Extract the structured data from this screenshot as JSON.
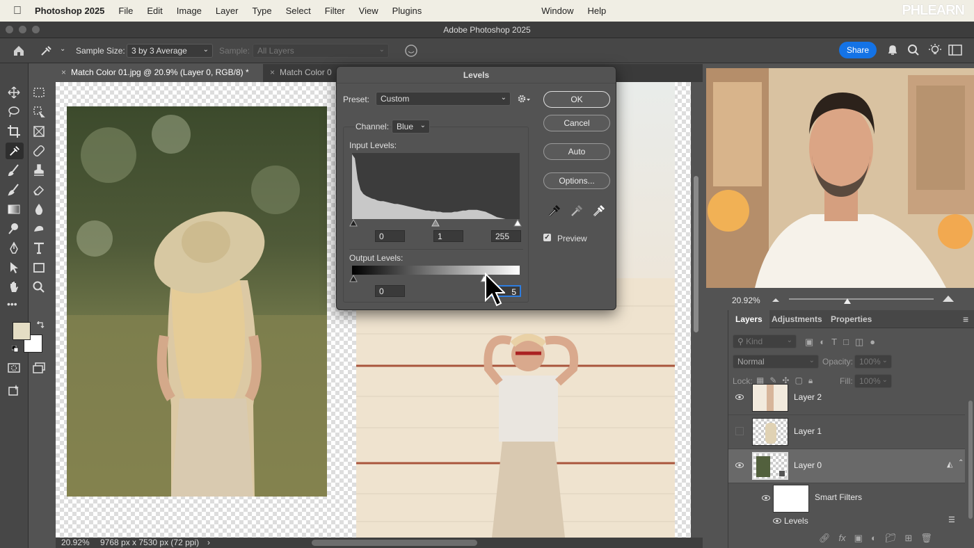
{
  "menubar": {
    "app_name": "Photoshop 2025",
    "items": [
      "File",
      "Edit",
      "Image",
      "Layer",
      "Type",
      "Select",
      "Filter",
      "View",
      "Plugins"
    ],
    "window": "Window",
    "help": "Help",
    "brand_watermark": "PHLEARN"
  },
  "window": {
    "title": "Adobe Photoshop 2025"
  },
  "options_bar": {
    "sample_size_label": "Sample Size:",
    "sample_size_value": "3 by 3 Average",
    "sample_label": "Sample:",
    "sample_value": "All Layers",
    "share_label": "Share",
    "accent_color": "#1473e6"
  },
  "tabs": [
    {
      "label": "Match Color 01.jpg @ 20.9% (Layer 0, RGB/8) *",
      "close": "×"
    },
    {
      "label": "Match Color 0",
      "close": "×"
    }
  ],
  "status_bar": {
    "zoom": "20.92%",
    "doc_info": "9768 px x 7530 px (72 ppi)",
    "arrow": "›"
  },
  "levels_dialog": {
    "title": "Levels",
    "preset_label": "Preset:",
    "preset_value": "Custom",
    "channel_label": "Channel:",
    "channel_value": "Blue",
    "input_levels_label": "Input Levels:",
    "input_black": "0",
    "input_gamma": "1",
    "input_white": "255",
    "output_levels_label": "Output Levels:",
    "output_black": "0",
    "output_white": "255",
    "output_white_visible": "5",
    "buttons": {
      "ok": "OK",
      "cancel": "Cancel",
      "auto": "Auto",
      "options": "Options..."
    },
    "preview_label": "Preview",
    "preview_checked": true,
    "histogram": [
      98,
      92,
      60,
      44,
      38,
      35,
      33,
      31,
      30,
      28,
      27,
      27,
      26,
      25,
      24,
      23,
      23,
      22,
      21,
      20,
      19,
      18,
      17,
      16,
      15,
      14,
      13,
      13,
      12,
      12,
      11,
      11,
      10,
      10,
      10,
      10,
      11,
      11,
      12,
      13,
      13,
      14,
      14,
      14,
      14,
      13,
      12,
      11,
      9,
      7,
      5,
      3,
      2,
      1,
      0,
      0,
      0,
      0,
      0,
      0
    ]
  },
  "navigator": {
    "zoom": "20.92%"
  },
  "layers_panel": {
    "tabs": [
      "Layers",
      "Adjustments",
      "Properties"
    ],
    "filter_placeholder": "Kind",
    "blend_mode": "Normal",
    "opacity_label": "Opacity:",
    "opacity_value": "100%",
    "lock_label": "Lock:",
    "fill_label": "Fill:",
    "fill_value": "100%",
    "layers": [
      {
        "name": "Layer 2",
        "visible": true,
        "selected": false
      },
      {
        "name": "Layer 1",
        "visible": false,
        "selected": false
      },
      {
        "name": "Layer 0",
        "visible": true,
        "selected": true
      }
    ],
    "smart_filters_label": "Smart Filters",
    "filter_name": "Levels"
  }
}
